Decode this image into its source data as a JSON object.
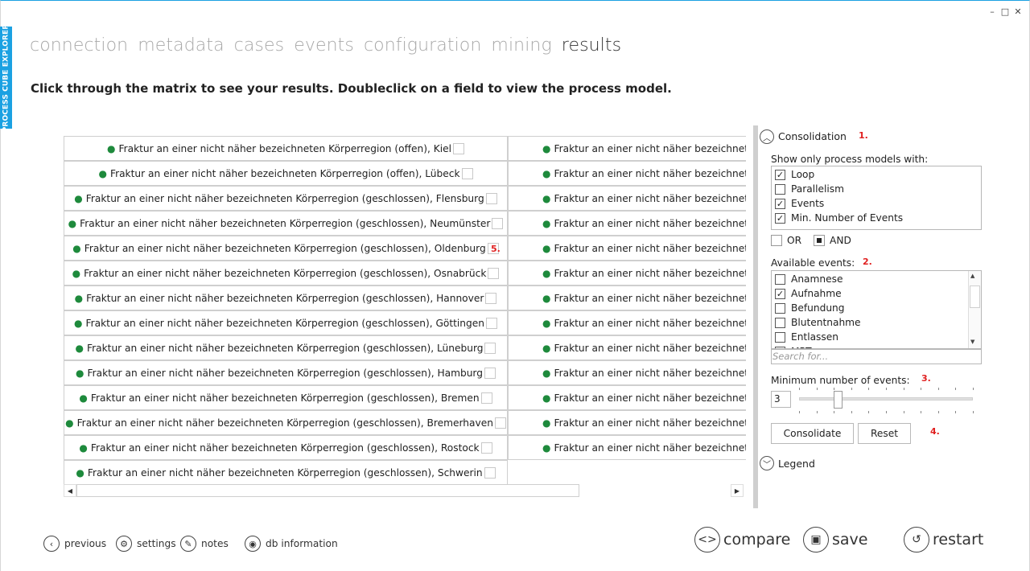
{
  "app": {
    "brand": "PROCESS CUBE EXPLORER"
  },
  "window_controls": {
    "minimize": "–",
    "maximize": "□",
    "close": "✕"
  },
  "nav": {
    "items": [
      "connection",
      "metadata",
      "cases",
      "events",
      "configuration",
      "mining",
      "results"
    ],
    "active": "results"
  },
  "instruction": "Click through the matrix to see your results. Doubleclick on a field to view the process model.",
  "matrix": {
    "left": [
      "Fraktur an einer nicht näher bezeichneten Körperregion (offen), Kiel",
      "Fraktur an einer nicht näher bezeichneten Körperregion (offen), Lübeck",
      "Fraktur an einer nicht näher bezeichneten Körperregion (geschlossen), Flensburg",
      "Fraktur an einer nicht näher bezeichneten Körperregion (geschlossen), Neumünster",
      "Fraktur an einer nicht näher bezeichneten Körperregion (geschlossen), Oldenburg",
      "Fraktur an einer nicht näher bezeichneten Körperregion (geschlossen), Osnabrück",
      "Fraktur an einer nicht näher bezeichneten Körperregion (geschlossen), Hannover",
      "Fraktur an einer nicht näher bezeichneten Körperregion (geschlossen), Göttingen",
      "Fraktur an einer nicht näher bezeichneten Körperregion (geschlossen), Lüneburg",
      "Fraktur an einer nicht näher bezeichneten Körperregion (geschlossen), Hamburg",
      "Fraktur an einer nicht näher bezeichneten Körperregion (geschlossen), Bremen",
      "Fraktur an einer nicht näher bezeichneten Körperregion (geschlossen), Bremerhaven",
      "Fraktur an einer nicht näher bezeichneten Körperregion (geschlossen), Rostock",
      "Fraktur an einer nicht näher bezeichneten Körperregion (geschlossen), Schwerin"
    ],
    "right": [
      "Fraktur an einer nicht näher bezeichneten",
      "Fraktur an einer nicht näher bezeichneten K",
      "Fraktur an einer nicht näher bezeichneten I",
      "Fraktur an einer nicht näher bezeichneten",
      "Fraktur an einer nicht näher bezeichneten",
      "Fraktur an einer nicht näher bezeichneter",
      "Fraktur an einer nicht näher bezeichneten",
      "Fraktur an einer nicht näher bezeichneter",
      "Fraktur an einer nicht näher bezeichneter",
      "Fraktur an einer nicht näher bezeichnete",
      "Fraktur an einer nicht näher bezeichneten K",
      "Fraktur an einer nicht näher bezeichnete",
      "Fraktur an einer nicht näher bezeichneter"
    ],
    "marker_5": "5."
  },
  "panel": {
    "consolidation": {
      "label": "Consolidation",
      "marker": "1."
    },
    "show_only_label": "Show only process models with:",
    "filters": [
      {
        "label": "Loop",
        "checked": true
      },
      {
        "label": "Parallelism",
        "checked": false
      },
      {
        "label": "Events",
        "checked": true
      },
      {
        "label": "Min. Number of Events",
        "checked": true
      }
    ],
    "logic": {
      "or_label": "OR",
      "and_label": "AND",
      "selected": "AND"
    },
    "available_events": {
      "label": "Available events:",
      "marker": "2.",
      "items": [
        {
          "label": "Anamnese",
          "checked": false
        },
        {
          "label": "Aufnahme",
          "checked": true
        },
        {
          "label": "Befundung",
          "checked": false
        },
        {
          "label": "Blutentnahme",
          "checked": false
        },
        {
          "label": "Entlassen",
          "checked": false
        },
        {
          "label": "MRT",
          "checked": false
        }
      ],
      "search_placeholder": "Search for..."
    },
    "min_events": {
      "label": "Minimum number of events:",
      "marker": "3.",
      "value": "3",
      "slider_fraction": 0.22
    },
    "buttons": {
      "consolidate": "Consolidate",
      "reset": "Reset",
      "marker": "4."
    },
    "legend": {
      "label": "Legend"
    }
  },
  "footer": {
    "previous": "previous",
    "settings": "settings",
    "notes": "notes",
    "db_information": "db information",
    "compare": "compare",
    "save": "save",
    "restart": "restart"
  },
  "colors": {
    "accent": "#1ba1e2",
    "marker": "#e02020",
    "dot": "#1e8a3c"
  }
}
